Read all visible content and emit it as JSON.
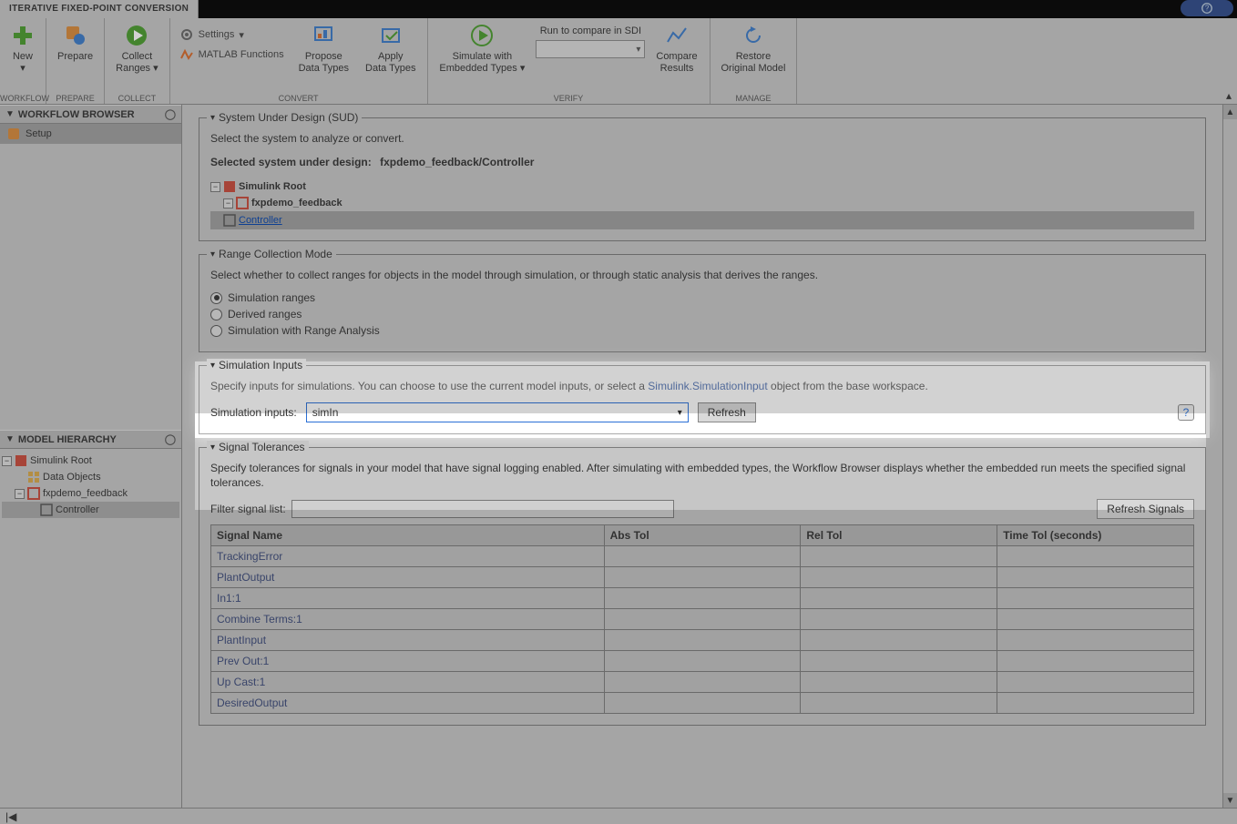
{
  "tab_title": "ITERATIVE FIXED-POINT CONVERSION",
  "ribbon": {
    "groups": {
      "workflow": {
        "label": "WORKFLOW",
        "new": "New"
      },
      "prepare": {
        "label": "PREPARE",
        "prepare": "Prepare"
      },
      "collect": {
        "label": "COLLECT",
        "collect": "Collect\nRanges"
      },
      "convert": {
        "label": "CONVERT",
        "settings": "Settings",
        "matlab": "MATLAB Functions",
        "propose": "Propose\nData Types",
        "apply": "Apply\nData Types"
      },
      "verify": {
        "label": "VERIFY",
        "simwith": "Simulate with\nEmbedded Types",
        "sdi": "Run to compare in SDI",
        "compare": "Compare\nResults"
      },
      "manage": {
        "label": "MANAGE",
        "restore": "Restore\nOriginal Model"
      }
    }
  },
  "left": {
    "workflow_browser": "WORKFLOW BROWSER",
    "setup": "Setup",
    "model_hierarchy": "MODEL HIERARCHY",
    "tree": {
      "root": "Simulink Root",
      "data_objects": "Data Objects",
      "model": "fxpdemo_feedback",
      "controller": "Controller"
    }
  },
  "sud": {
    "legend": "System Under Design (SUD)",
    "instr": "Select the system to analyze or convert.",
    "sel_label": "Selected system under design:",
    "sel_value": "fxpdemo_feedback/Controller",
    "tree": {
      "root": "Simulink Root",
      "model": "fxpdemo_feedback",
      "controller": "Controller"
    }
  },
  "range": {
    "legend": "Range Collection Mode",
    "instr": "Select whether to collect ranges for objects in the model through simulation, or through static analysis that derives the ranges.",
    "opt1": "Simulation ranges",
    "opt2": "Derived ranges",
    "opt3": "Simulation with Range Analysis"
  },
  "simin": {
    "legend": "Simulation Inputs",
    "instr_pre": "Specify inputs for simulations. You can choose to use the current model inputs, or select a ",
    "instr_link": "Simulink.SimulationInput",
    "instr_post": " object from the base workspace.",
    "label": "Simulation inputs:",
    "value": "simIn",
    "refresh": "Refresh"
  },
  "sigtol": {
    "legend": "Signal Tolerances",
    "instr": "Specify tolerances for signals in your model that have signal logging enabled. After simulating with embedded types, the Workflow Browser displays whether the embedded run meets the specified signal tolerances.",
    "filter_label": "Filter signal list:",
    "refresh": "Refresh Signals",
    "cols": {
      "name": "Signal Name",
      "abs": "Abs Tol",
      "rel": "Rel Tol",
      "time": "Time Tol (seconds)"
    },
    "rows": [
      "TrackingError",
      "PlantOutput",
      "In1:1",
      "Combine Terms:1",
      "PlantInput",
      "Prev Out:1",
      "Up Cast:1",
      "DesiredOutput"
    ]
  }
}
